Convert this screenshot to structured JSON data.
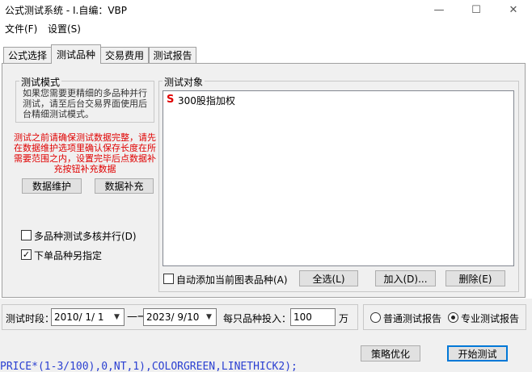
{
  "window": {
    "title": "公式测试系统 - I.自编：VBP",
    "minimize": "—",
    "maximize": "☐",
    "close": "✕"
  },
  "menu": [
    "文件(F)",
    "设置(S)"
  ],
  "tabs": [
    "公式选择",
    "测试品种",
    "交易费用",
    "测试报告"
  ],
  "mode": {
    "label": "测试模式",
    "description": "如果您需要更精细的多品种并行测试，请至后台交易界面使用后台精细测试模式。"
  },
  "warning": "测试之前请确保测试数据完整，请先在数据维护选项里确认保存长度在所需要范围之内，设置完毕后点数据补充按钮补充数据",
  "buttons": {
    "data_maintain": "数据维护",
    "data_supplement": "数据补充",
    "select_all": "全选(L)",
    "add": "加入(D)...",
    "delete": "删除(E)",
    "strategy": "策略优化",
    "start": "开始测试"
  },
  "options": {
    "multicore": {
      "label": "多品种测试多核并行(D)",
      "checked": false,
      "mark": ""
    },
    "order_specify": {
      "label": "下单品种另指定",
      "checked": true,
      "mark": "✓"
    },
    "auto_add": {
      "label": "自动添加当前图表品种(A)",
      "checked": false
    }
  },
  "targets": {
    "label": "测试对象",
    "items": [
      {
        "marker": "S",
        "name": "300股指加权"
      }
    ]
  },
  "period": {
    "label": "测试时段：",
    "start": "2010/ 1/ 1",
    "arrow": "—→",
    "end": "2023/ 9/10",
    "invest_label": "每只品种投入：",
    "invest_value": "100",
    "unit": "万"
  },
  "report": {
    "normal": "普通测试报告",
    "professional": "专业测试报告",
    "selected": "professional"
  },
  "background_code": "PRICE*(1-3/100),0,NT,1),COLORGREEN,LINETHICK2);"
}
